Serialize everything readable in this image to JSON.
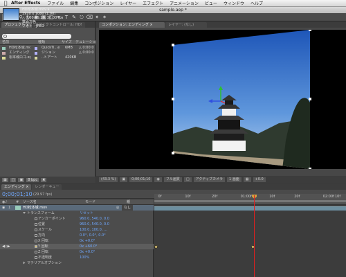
{
  "menubar": {
    "app_name": "After Effects",
    "items": [
      "ファイル",
      "編集",
      "コンポジション",
      "レイヤー",
      "エフェクト",
      "アニメーション",
      "ビュー",
      "ウィンドウ",
      "ヘルプ"
    ]
  },
  "window": {
    "title": "sample.aep *"
  },
  "toolbar": {
    "tools": [
      "selection-tool",
      "hand-tool",
      "zoom-tool",
      "rotate-tool",
      "camera-tool",
      "pan-behind-tool",
      "pen-tool",
      "type-tool",
      "brush-tool",
      "clone-tool",
      "eraser-tool",
      "roto-tool",
      "puppet-tool"
    ]
  },
  "project_panel": {
    "tabs": [
      "プロジェクト ×",
      "エフェクトコントロール: HD!"
    ],
    "file": {
      "name": "HD松本城.mov ▾",
      "dims": "1920 x 1080 (1.00)",
      "duration": "△ 0:00:05:29, 30.00 fps",
      "colors": "数百万色",
      "codec": "フォト - JPEG"
    },
    "search_placeholder": "",
    "columns": [
      "名前",
      "",
      "種類",
      "サイズ",
      "デュレーション"
    ],
    "rows": [
      {
        "name": "HD松本城.mov",
        "label_color": "#b0b0ff",
        "type": "QuickTi...e",
        "size": "6MB",
        "dur": "△ 0:00:0"
      },
      {
        "name": "エンディング",
        "label_color": "#b0b0ff",
        "type": "ジション",
        "size": "",
        "dur": "△ 0:00:0"
      },
      {
        "name": "松本城ロゴ.eps",
        "label_color": "#d8d8a0",
        "type": "..トアート",
        "size": "420KB",
        "dur": ""
      }
    ],
    "footer_bpc": "8 bpc"
  },
  "comp_panel": {
    "tabs": [
      "コンポジション: エンディング ×",
      "レイヤー: (なし)"
    ],
    "zoom": "(43.3 %)",
    "time": "0;00;01;10",
    "resolution": "フル画質",
    "camera": "アクティブカメラ",
    "views": "1 画面",
    "exposure": "+0.0"
  },
  "timeline": {
    "tabs": [
      "エンディング ×",
      "レンダーキュー"
    ],
    "timecode": "0;00;01;10",
    "fps": "(29.97 fps)",
    "columns": [
      "#",
      "ソース名",
      "モード",
      "親"
    ],
    "layer": {
      "num": "1",
      "name": "HD松本城.mov",
      "parent": "なし"
    },
    "ruler_ticks": [
      "0f",
      "10f",
      "20f",
      "01:00f",
      "10f",
      "20f",
      "02:00f",
      "10f"
    ],
    "ruler_positions": [
      0.02,
      0.16,
      0.3,
      0.45,
      0.6,
      0.73,
      0.88,
      0.99
    ],
    "cti_fraction": 0.52,
    "props": [
      {
        "name": "トランスフォーム",
        "value": "リセット"
      },
      {
        "name": "アンカーポイント",
        "value": "960.0, 540.0, 0.0"
      },
      {
        "name": "位置",
        "value": "960.0, 540.0, 0.0"
      },
      {
        "name": "スケール",
        "value": "100.0, 100.0, ..."
      },
      {
        "name": "方向",
        "value": "0.0°, 0.0°, 0.0°"
      },
      {
        "name": "X 回転",
        "value": "0x +0.0°"
      },
      {
        "name": "Y 回転",
        "value": "0x +60.0°"
      },
      {
        "name": "Z 回転",
        "value": "0x +0.0°"
      },
      {
        "name": "不透明度",
        "value": "100%"
      },
      {
        "name": "マテリアルオプション",
        "value": ""
      }
    ]
  }
}
